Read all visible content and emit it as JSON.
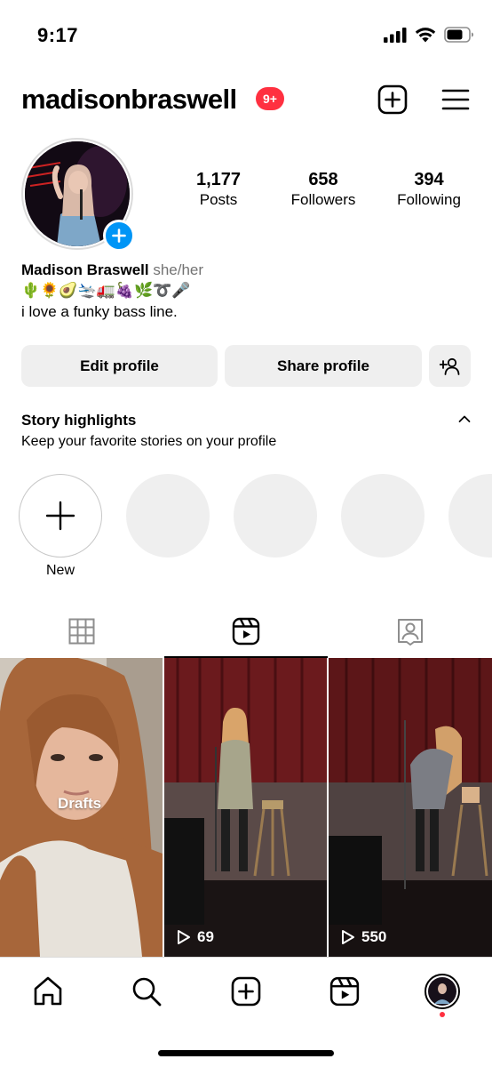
{
  "status_bar": {
    "time": "9:17"
  },
  "header": {
    "username": "madisonbraswell",
    "notification_badge": "9+"
  },
  "profile": {
    "stats": [
      {
        "value": "1,177",
        "label": "Posts"
      },
      {
        "value": "658",
        "label": "Followers"
      },
      {
        "value": "394",
        "label": "Following"
      }
    ],
    "name": "Madison Braswell",
    "pronouns": "she/her",
    "bio_emojis": "🌵🌻🥑🛬🚛🍇🌿➰🎤",
    "bio_text": "i love a funky bass line."
  },
  "buttons": {
    "edit_profile": "Edit profile",
    "share_profile": "Share profile"
  },
  "story_highlights": {
    "title": "Story highlights",
    "subtitle": "Keep your favorite stories on your profile",
    "new_label": "New"
  },
  "tabs": [
    {
      "icon": "grid-icon"
    },
    {
      "icon": "reels-icon",
      "selected": true
    },
    {
      "icon": "tagged-icon"
    }
  ],
  "reels": [
    {
      "label": "Drafts"
    },
    {
      "views": "69"
    },
    {
      "views": "550"
    }
  ],
  "bottom_nav": [
    "home-icon",
    "search-icon",
    "create-icon",
    "reels-icon",
    "profile-avatar"
  ],
  "colors": {
    "accent_blue": "#0095f6",
    "badge_red": "#ff3040",
    "button_gray": "#efefef"
  }
}
